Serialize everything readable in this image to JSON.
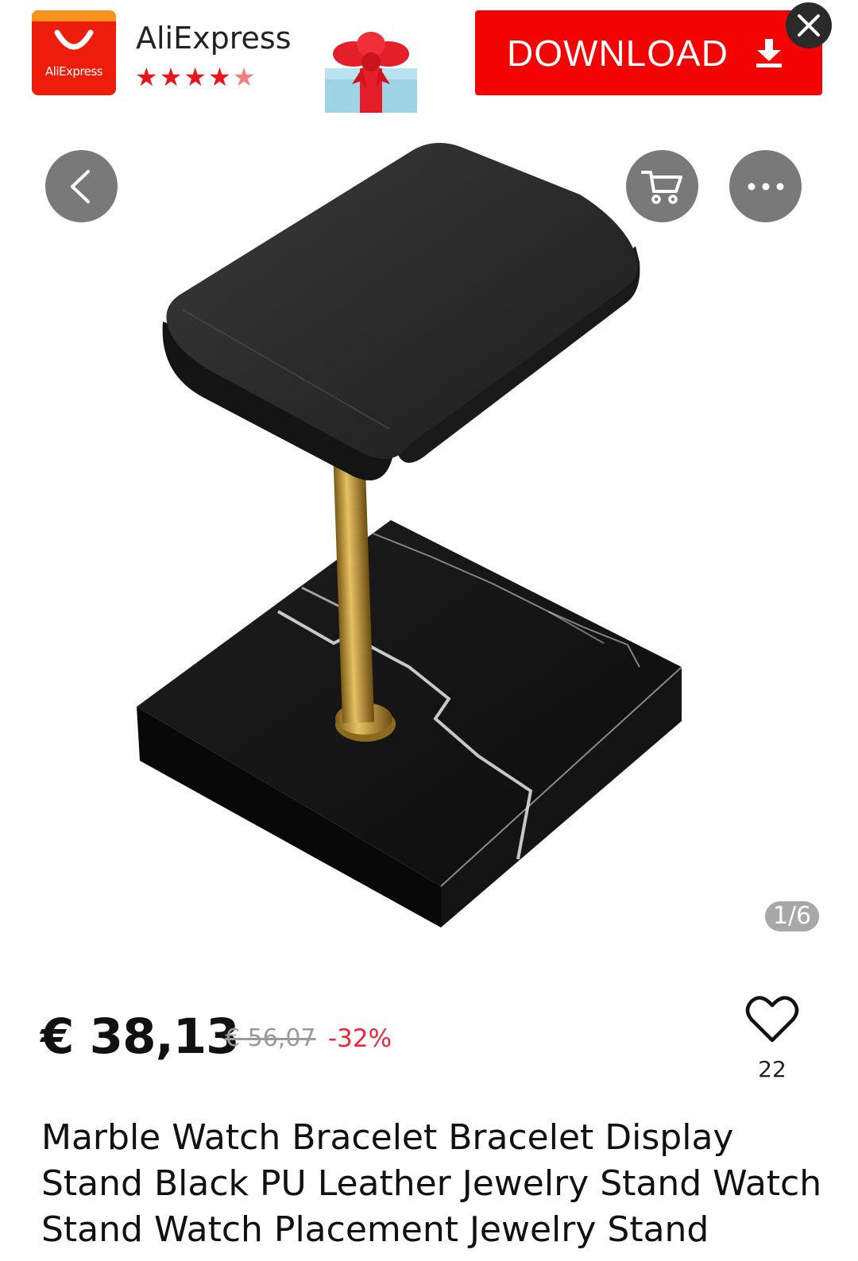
{
  "banner": {
    "logo_text": "AliExpress",
    "app_name": "AliExpress",
    "rating": 4.5,
    "stars": "★★★★",
    "half_star": "★",
    "download_label": "DOWNLOAD",
    "download_icon": "download-arrow-icon",
    "close_icon": "close-icon",
    "brand_red": "#f40303",
    "brand_orange": "#f7941d"
  },
  "gallery": {
    "back_icon": "chevron-left-icon",
    "cart_icon": "shopping-cart-icon",
    "more_icon": "more-dots-icon",
    "counter": "1/6"
  },
  "product": {
    "price": "€ 38,13",
    "original_price": "€ 56,07",
    "discount": "-32%",
    "wishlist_count": "22",
    "title": "Marble Watch Bracelet Bracelet Display Stand Black PU Leather Jewelry Stand Watch Stand Watch Placement Jewelry Stand"
  }
}
